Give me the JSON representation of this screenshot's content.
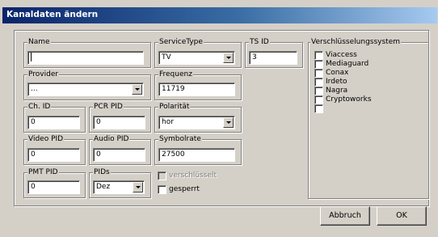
{
  "window": {
    "title": "Kanaldaten ändern"
  },
  "fields": {
    "name": {
      "label": "Name",
      "value": ""
    },
    "service_type": {
      "label": "ServiceType",
      "value": "TV"
    },
    "ts_id": {
      "label": "TS ID",
      "value": "3"
    },
    "provider": {
      "label": "Provider",
      "value": "..."
    },
    "frequenz": {
      "label": "Frequenz",
      "value": "11719"
    },
    "ch_id": {
      "label": "Ch. ID",
      "value": "0"
    },
    "pcr_pid": {
      "label": "PCR PID",
      "value": "0"
    },
    "polaritaet": {
      "label": "Polarität",
      "value": "hor"
    },
    "video_pid": {
      "label": "Video PID",
      "value": "0"
    },
    "audio_pid": {
      "label": "Audio PID",
      "value": "0"
    },
    "symbolrate": {
      "label": "Symbolrate",
      "value": "27500"
    },
    "pmt_pid": {
      "label": "PMT PID",
      "value": "0"
    },
    "pids": {
      "label": "PIDs",
      "value": "Dez"
    }
  },
  "checkboxes": {
    "verschluesselt": {
      "label": "verschlüsselt",
      "checked": false,
      "disabled": true
    },
    "gesperrt": {
      "label": "gesperrt",
      "checked": false,
      "disabled": false
    }
  },
  "encryption": {
    "label": "Verschlüsselungssystem",
    "items": [
      {
        "label": "Viaccess",
        "checked": false
      },
      {
        "label": "Mediaguard",
        "checked": false
      },
      {
        "label": "Conax",
        "checked": false
      },
      {
        "label": "Irdeto",
        "checked": false
      },
      {
        "label": "Nagra",
        "checked": false
      },
      {
        "label": "Cryptoworks",
        "checked": false
      },
      {
        "label": "",
        "checked": false
      }
    ]
  },
  "buttons": {
    "cancel": "Abbruch",
    "ok": "OK"
  }
}
